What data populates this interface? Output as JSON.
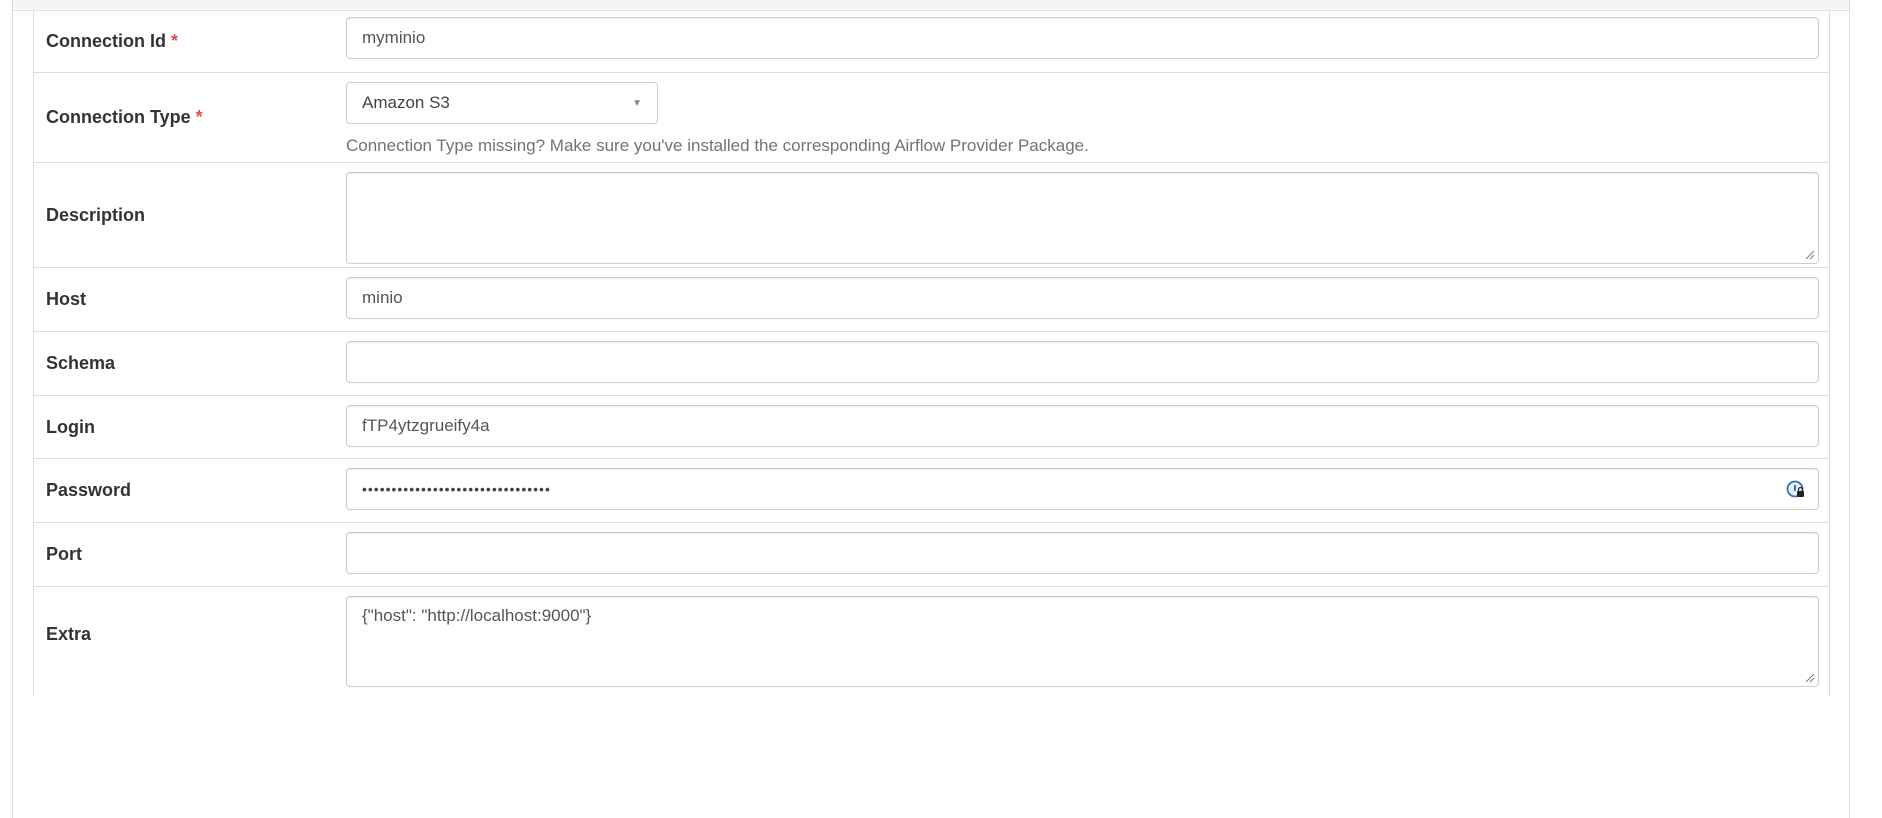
{
  "form": {
    "connection_id": {
      "label": "Connection Id",
      "required_mark": "*",
      "value": "myminio"
    },
    "connection_type": {
      "label": "Connection Type",
      "required_mark": "*",
      "selected": "Amazon S3",
      "help": "Connection Type missing? Make sure you've installed the corresponding Airflow Provider Package."
    },
    "description": {
      "label": "Description",
      "value": ""
    },
    "host": {
      "label": "Host",
      "value": "minio"
    },
    "schema": {
      "label": "Schema",
      "value": ""
    },
    "login": {
      "label": "Login",
      "value": "fTP4ytzgrueify4a"
    },
    "password": {
      "label": "Password",
      "masked_value": "••••••••••••••••••••••••••••••••",
      "manager_icon": "password-manager-icon"
    },
    "port": {
      "label": "Port",
      "value": ""
    },
    "extra": {
      "label": "Extra",
      "value": "{\"host\": \"http://localhost:9000\"}"
    }
  },
  "colors": {
    "required": "#d9534f",
    "border": "#cccccc",
    "row_divider": "#dddddd",
    "label_text": "#333333",
    "help_text": "#737373"
  }
}
